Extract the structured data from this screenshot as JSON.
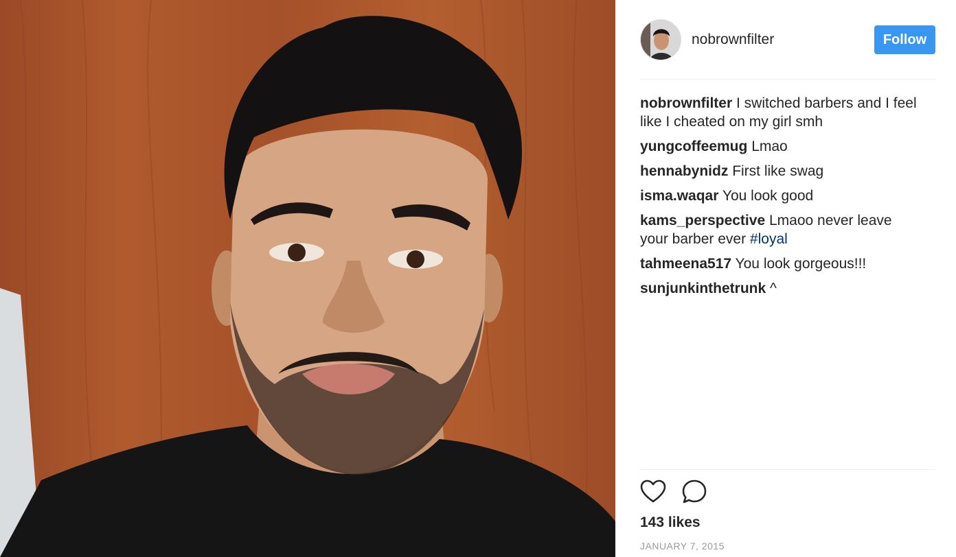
{
  "post": {
    "author": "nobrownfilter",
    "follow_label": "Follow",
    "caption": {
      "user": "nobrownfilter",
      "text": "I switched barbers and I feel like I cheated on my girl smh"
    },
    "comments": [
      {
        "user": "yungcoffeemug",
        "text": "Lmao"
      },
      {
        "user": "hennabynidz",
        "text": "First like swag"
      },
      {
        "user": "isma.waqar",
        "text": "You look good"
      },
      {
        "user": "kams_perspective",
        "text": "Lmaoo never leave your barber ever",
        "hashtag": "#loyal"
      },
      {
        "user": "tahmeena517",
        "text": "You look gorgeous!!!"
      },
      {
        "user": "sunjunkinthetrunk",
        "text": "^"
      }
    ],
    "likes": "143 likes",
    "date": "JANUARY 7, 2015"
  },
  "icons": {
    "like": "heart-icon",
    "comment": "speech-bubble-icon"
  },
  "colors": {
    "follow_button": "#3897f0",
    "hashtag": "#003569",
    "divider": "#efefef",
    "date": "#999999"
  }
}
